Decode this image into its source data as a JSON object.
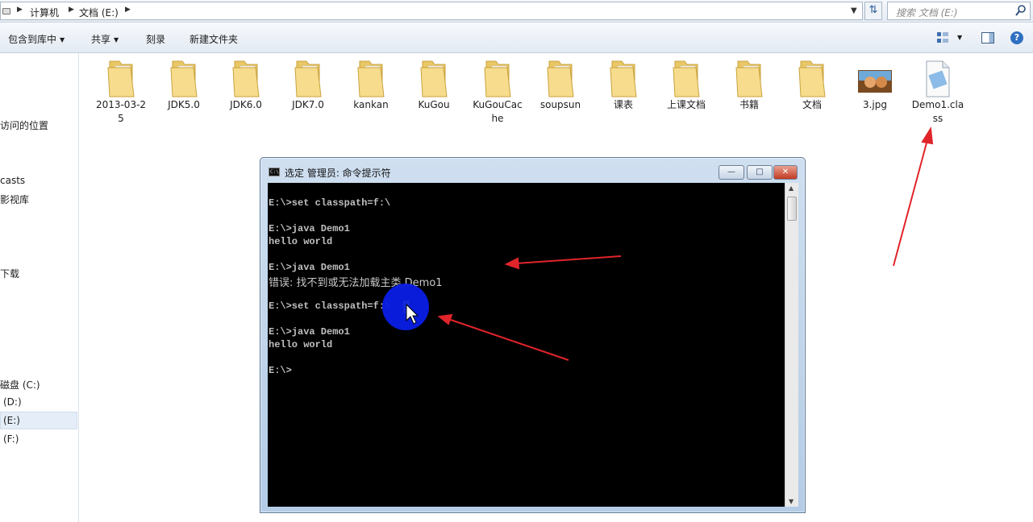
{
  "address": {
    "crumbs": [
      "计算机",
      "文档 (E:)"
    ],
    "search_placeholder": "搜索 文档 (E:)"
  },
  "toolbar": {
    "library": "包含到库中",
    "share": "共享",
    "burn": "刻录",
    "new_folder": "新建文件夹"
  },
  "sidebar": {
    "items": [
      "访问的位置",
      "casts",
      "影视库",
      "下载",
      "磁盘 (C:)",
      "(D:)",
      "(E:)",
      "(F:)"
    ]
  },
  "files": [
    {
      "name": "2013-03-25",
      "label_lines": [
        "2013-03-2",
        "5"
      ],
      "icon": "folder"
    },
    {
      "name": "JDK5.0",
      "label_lines": [
        "JDK5.0"
      ],
      "icon": "folder"
    },
    {
      "name": "JDK6.0",
      "label_lines": [
        "JDK6.0"
      ],
      "icon": "folder"
    },
    {
      "name": "JDK7.0",
      "label_lines": [
        "JDK7.0"
      ],
      "icon": "folder"
    },
    {
      "name": "kankan",
      "label_lines": [
        "kankan"
      ],
      "icon": "folder"
    },
    {
      "name": "KuGou",
      "label_lines": [
        "KuGou"
      ],
      "icon": "folder"
    },
    {
      "name": "KuGouCache",
      "label_lines": [
        "KuGouCac",
        "he"
      ],
      "icon": "folder"
    },
    {
      "name": "soupsun",
      "label_lines": [
        "soupsun"
      ],
      "icon": "folder"
    },
    {
      "name": "课表",
      "label_lines": [
        "课表"
      ],
      "icon": "folder"
    },
    {
      "name": "上课文档",
      "label_lines": [
        "上课文档"
      ],
      "icon": "folder"
    },
    {
      "name": "书籍",
      "label_lines": [
        "书籍"
      ],
      "icon": "folder"
    },
    {
      "name": "文档",
      "label_lines": [
        "文档"
      ],
      "icon": "folder"
    },
    {
      "name": "3.jpg",
      "label_lines": [
        "3.jpg"
      ],
      "icon": "image-thumbnail"
    },
    {
      "name": "Demo1.class",
      "label_lines": [
        "Demo1.cla",
        "ss"
      ],
      "icon": "class-file"
    }
  ],
  "cmd": {
    "title": "选定 管理员: 命令提示符",
    "minimize": "—",
    "maximize": "□",
    "close": "✕",
    "lines": [
      "E:\\>set classpath=f:\\",
      "E:\\>java Demo1",
      "hello world",
      "E:\\>java Demo1",
      "错误: 找不到或无法加载主类 Demo1",
      "E:\\>set classpath=f:\\",
      "E:\\>java Demo1",
      "hello world",
      "E:\\>"
    ]
  },
  "colors": {
    "console_bg": "#000000",
    "console_text": "#c0c0c0",
    "annotation_arrow": "#e0242a",
    "click_marker": "#0a1ee6",
    "selection_highlight": "#ffee00"
  }
}
